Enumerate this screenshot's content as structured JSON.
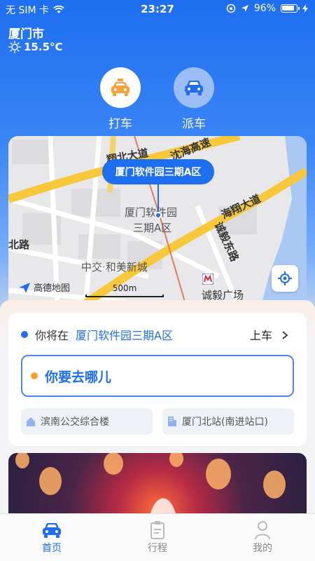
{
  "status_bar": {
    "carrier": "无 SIM 卡",
    "time": "23:27",
    "battery": "96%"
  },
  "header": {
    "city": "厦门市",
    "temperature": "15.5°C"
  },
  "services": [
    {
      "label": "打车",
      "icon": "taxi-icon"
    },
    {
      "label": "派车",
      "icon": "car-icon"
    }
  ],
  "map": {
    "pin_label": "厦门软件园三期A区",
    "place_label_1": "厦门软件园",
    "place_label_2": "三期A区",
    "road_1": "沈海高速",
    "road_2_a": "翔北大道",
    "road_3": "海翔大道",
    "road_4": "诚毅东路",
    "road_5": "北路",
    "community": "中交·和美新城",
    "metro_station": "诚毅广场",
    "logo_text": "高德地图",
    "scale": "500m"
  },
  "pickup": {
    "prefix": "你将在",
    "place": "厦门软件园三期A区",
    "action": "上车"
  },
  "destination": {
    "placeholder": "你要去哪儿"
  },
  "suggestions": [
    {
      "label": "滨南公交综合楼",
      "icon": "home-icon"
    },
    {
      "label": "厦门北站(南进站口)",
      "icon": "building-icon"
    }
  ],
  "tabs": [
    {
      "label": "首页",
      "icon": "car-icon"
    },
    {
      "label": "行程",
      "icon": "clipboard-icon"
    },
    {
      "label": "我的",
      "icon": "person-icon"
    }
  ],
  "colors": {
    "primary": "#1e6ef0",
    "taxi_orange": "#f5a23a"
  }
}
